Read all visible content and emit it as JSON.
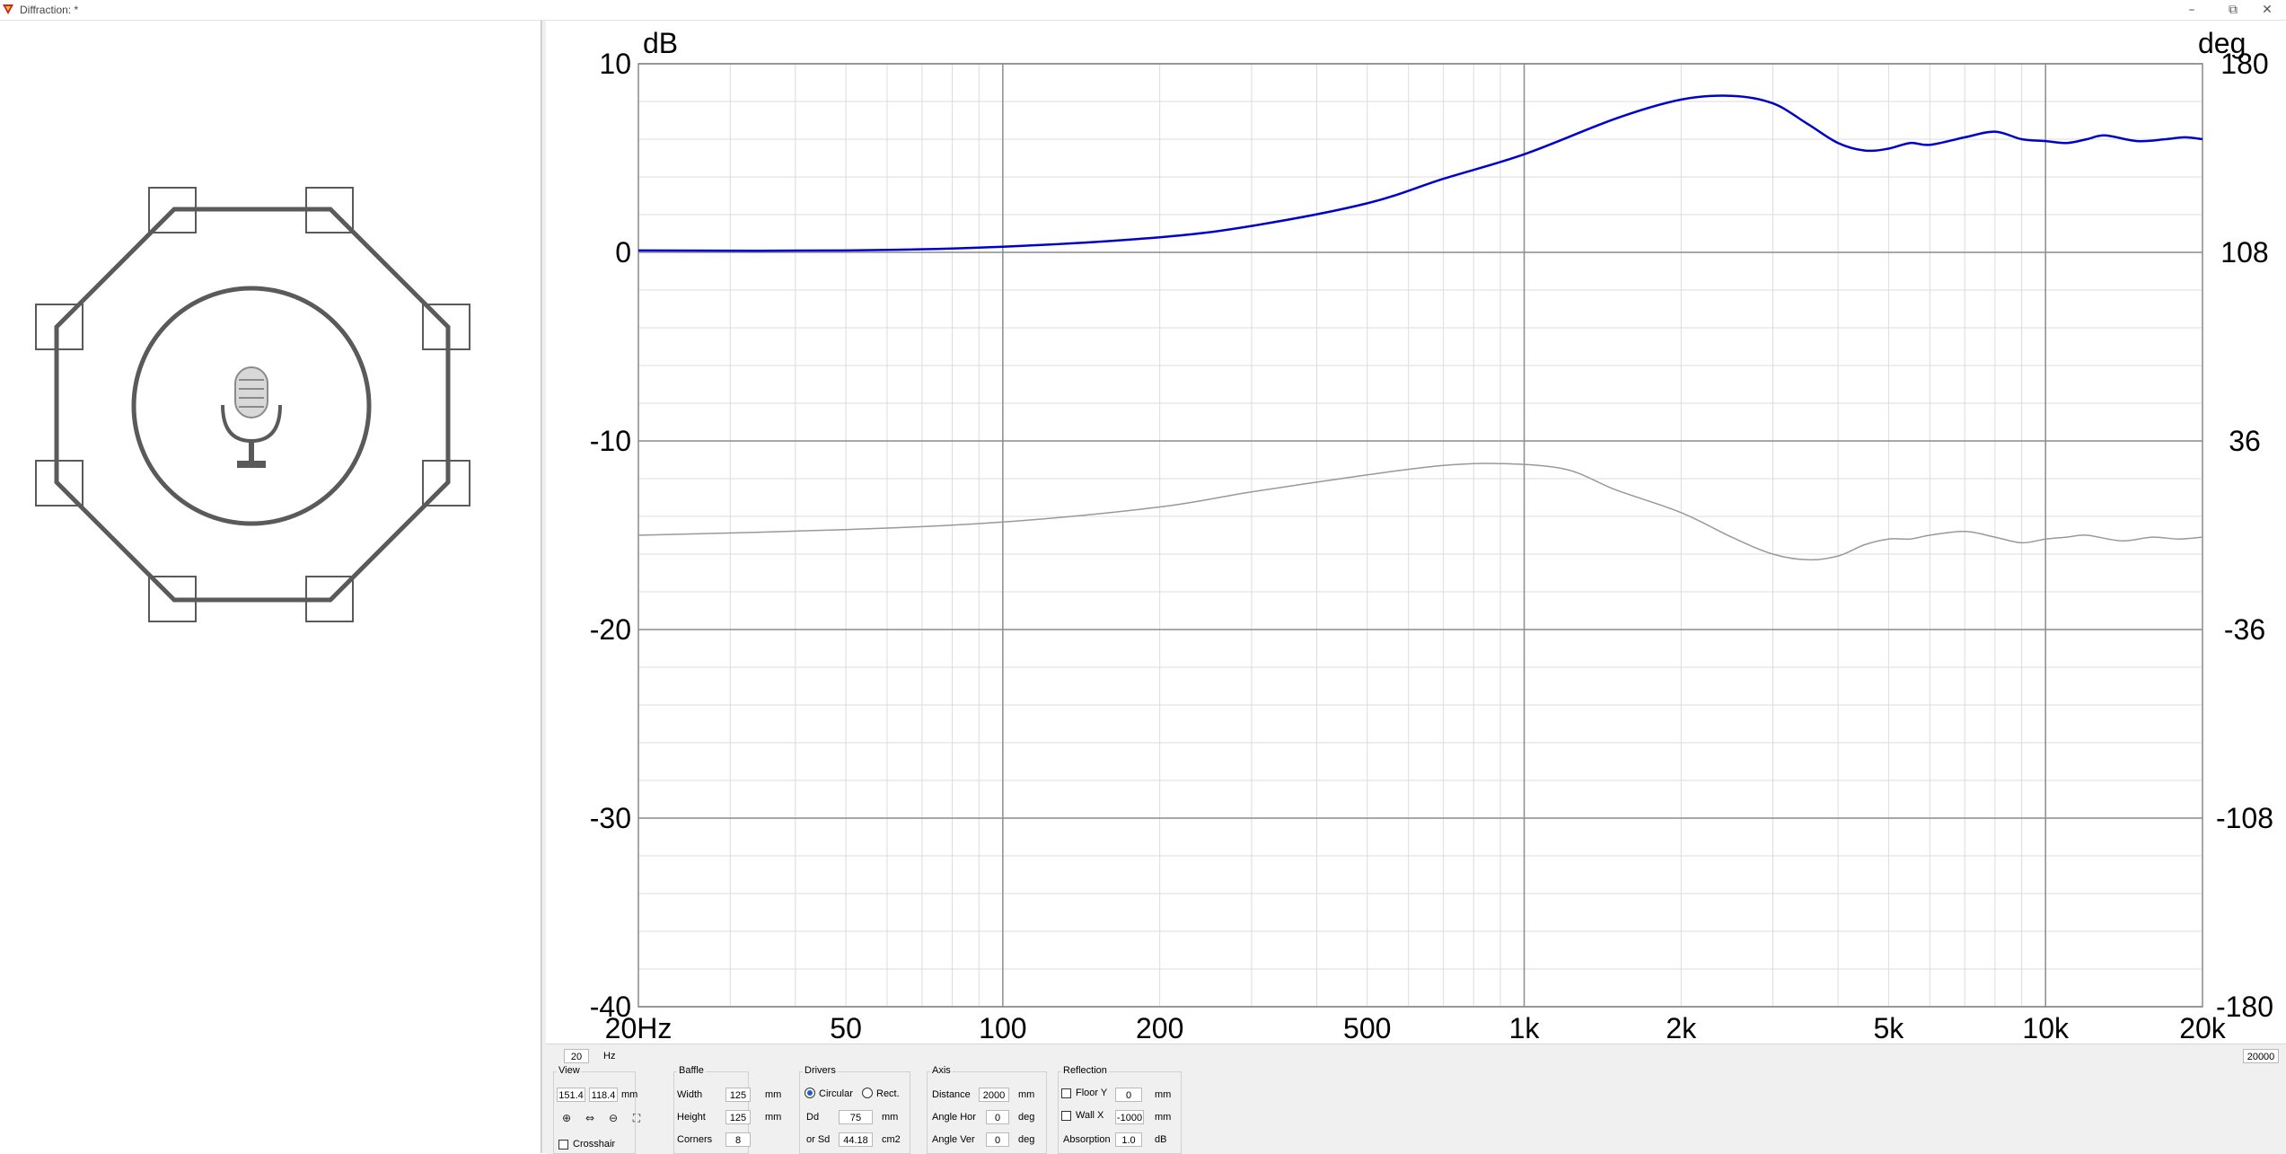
{
  "window": {
    "title": "Diffraction: *",
    "app_icon": "speaker-app-icon",
    "buttons": {
      "minimize": "–",
      "restore": "⧉",
      "close": "✕"
    }
  },
  "baffle_view": {
    "shape": "octagon",
    "corners": 8,
    "microphone_icon": "microphone-icon"
  },
  "chart_data": {
    "type": "line",
    "x_scale": "log",
    "xlim": [
      20,
      20000
    ],
    "ylim_left": [
      -40,
      10
    ],
    "ylim_right": [
      -180,
      180
    ],
    "left_unit": "dB",
    "right_unit": "deg",
    "x_tick_labels": [
      {
        "value": 20,
        "label": "20Hz"
      },
      {
        "value": 50,
        "label": "50"
      },
      {
        "value": 100,
        "label": "100"
      },
      {
        "value": 200,
        "label": "200"
      },
      {
        "value": 500,
        "label": "500"
      },
      {
        "value": 1000,
        "label": "1k"
      },
      {
        "value": 2000,
        "label": "2k"
      },
      {
        "value": 5000,
        "label": "5k"
      },
      {
        "value": 10000,
        "label": "10k"
      },
      {
        "value": 20000,
        "label": "20k"
      }
    ],
    "y_left_ticks": [
      {
        "value": 10,
        "label": "10"
      },
      {
        "value": 0,
        "label": "0"
      },
      {
        "value": -10,
        "label": "-10"
      },
      {
        "value": -20,
        "label": "-20"
      },
      {
        "value": -30,
        "label": "-30"
      },
      {
        "value": -40,
        "label": "-40"
      }
    ],
    "y_right_ticks": [
      {
        "value": 180,
        "label": "180"
      },
      {
        "value": 108,
        "label": "108"
      },
      {
        "value": 36,
        "label": "36"
      },
      {
        "value": -36,
        "label": "-36"
      },
      {
        "value": -108,
        "label": "-108"
      },
      {
        "value": -180,
        "label": "-180"
      }
    ],
    "grid": true,
    "series": [
      {
        "axis": "left",
        "color": "#0000cc",
        "points": [
          [
            20,
            0.1
          ],
          [
            50,
            0.1
          ],
          [
            100,
            0.3
          ],
          [
            200,
            0.8
          ],
          [
            300,
            1.4
          ],
          [
            500,
            2.6
          ],
          [
            700,
            3.9
          ],
          [
            1000,
            5.2
          ],
          [
            1500,
            7.1
          ],
          [
            2000,
            8.1
          ],
          [
            2500,
            8.3
          ],
          [
            3000,
            7.9
          ],
          [
            3500,
            6.8
          ],
          [
            4000,
            5.8
          ],
          [
            4500,
            5.4
          ],
          [
            5000,
            5.5
          ],
          [
            5500,
            5.8
          ],
          [
            6000,
            5.7
          ],
          [
            7000,
            6.1
          ],
          [
            8000,
            6.4
          ],
          [
            9000,
            6.0
          ],
          [
            10000,
            5.9
          ],
          [
            11000,
            5.8
          ],
          [
            12000,
            6.0
          ],
          [
            13000,
            6.2
          ],
          [
            15000,
            5.9
          ],
          [
            17000,
            6.0
          ],
          [
            18500,
            6.1
          ],
          [
            20000,
            6.0
          ]
        ]
      },
      {
        "axis": "left",
        "color": "#999999",
        "points": [
          [
            20,
            -15.0
          ],
          [
            50,
            -14.7
          ],
          [
            100,
            -14.3
          ],
          [
            200,
            -13.5
          ],
          [
            300,
            -12.7
          ],
          [
            500,
            -11.8
          ],
          [
            700,
            -11.3
          ],
          [
            900,
            -11.2
          ],
          [
            1200,
            -11.5
          ],
          [
            1500,
            -12.6
          ],
          [
            2000,
            -13.8
          ],
          [
            2500,
            -15.1
          ],
          [
            3000,
            -16.0
          ],
          [
            3500,
            -16.3
          ],
          [
            4000,
            -16.1
          ],
          [
            4500,
            -15.5
          ],
          [
            5000,
            -15.2
          ],
          [
            5500,
            -15.2
          ],
          [
            6000,
            -15.0
          ],
          [
            7000,
            -14.8
          ],
          [
            8000,
            -15.1
          ],
          [
            9000,
            -15.4
          ],
          [
            10000,
            -15.2
          ],
          [
            11000,
            -15.1
          ],
          [
            12000,
            -15.0
          ],
          [
            14000,
            -15.3
          ],
          [
            16000,
            -15.1
          ],
          [
            18000,
            -15.2
          ],
          [
            20000,
            -15.1
          ]
        ]
      }
    ]
  },
  "controls": {
    "freq_min": "20",
    "freq_unit": "Hz",
    "freq_max": "20000",
    "view": {
      "title": "View",
      "width": "151.4",
      "height": "118.4",
      "unit": "mm",
      "crosshair_label": "Crosshair",
      "crosshair_checked": false
    },
    "baffle": {
      "title": "Baffle",
      "width_label": "Width",
      "width": "125",
      "width_unit": "mm",
      "height_label": "Height",
      "height": "125",
      "height_unit": "mm",
      "corners_label": "Corners",
      "corners": "8"
    },
    "drivers": {
      "title": "Drivers",
      "circular_label": "Circular",
      "circular_selected": true,
      "rect_label": "Rect.",
      "dd_label": "Dd",
      "dd": "75",
      "dd_unit": "mm",
      "sd_label": "or Sd",
      "sd": "44.18",
      "sd_unit": "cm2"
    },
    "axis": {
      "title": "Axis",
      "distance_label": "Distance",
      "distance": "2000",
      "distance_unit": "mm",
      "angle_hor_label": "Angle Hor",
      "angle_hor": "0",
      "angle_hor_unit": "deg",
      "angle_ver_label": "Angle Ver",
      "angle_ver": "0",
      "angle_ver_unit": "deg"
    },
    "reflection": {
      "title": "Reflection",
      "floor_label": "Floor Y",
      "floor": "0",
      "floor_unit": "mm",
      "wall_label": "Wall  X",
      "wall": "-1000",
      "wall_unit": "mm",
      "absorption_label": "Absorption",
      "absorption": "1.0",
      "absorption_unit": "dB"
    }
  }
}
